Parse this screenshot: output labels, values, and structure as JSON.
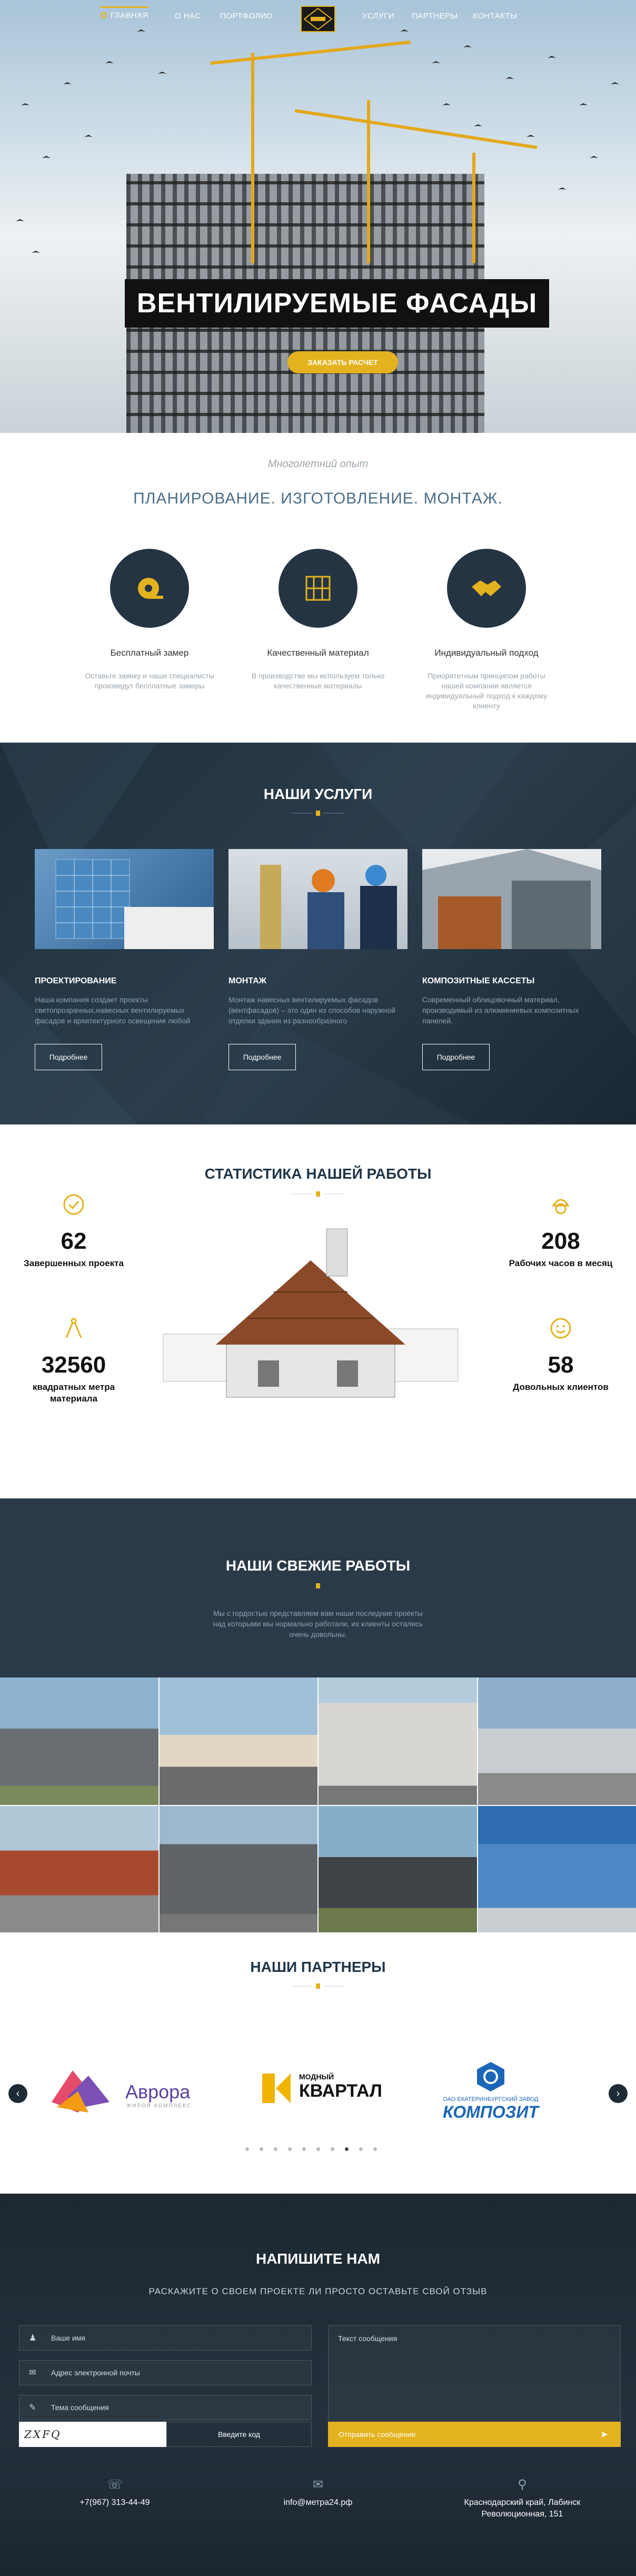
{
  "nav": {
    "left": [
      "ГЛАВНАЯ",
      "О НАС",
      "ПОРТФОЛИО"
    ],
    "right": [
      "УСЛУГИ",
      "ПАРТНЕРЫ",
      "КОНТАКТЫ"
    ],
    "logo_text": "ВЕНТФАСАД"
  },
  "hero": {
    "title": "ВЕНТИЛИРУЕМЫЕ ФАСАДЫ",
    "button": "ЗАКАЗАТЬ РАСЧЕТ"
  },
  "features": {
    "subtitle": "Многолетний опыт",
    "heading": "ПЛАНИРОВАНИЕ. ИЗГОТОВЛЕНИЕ. МОНТАЖ.",
    "items": [
      {
        "title": "Бесплатный замер",
        "desc": "Оставьте заявку и наши специалисты произведут бесплатные замеры",
        "icon": "tape-measure-icon"
      },
      {
        "title": "Качественный материал",
        "desc": "В производстве мы используем только качественные материалы",
        "icon": "material-panels-icon"
      },
      {
        "title": "Индивидуальный подход",
        "desc": "Приоритетным принципом работы нашей компании является индивидуальный подход к каждому клиенту",
        "icon": "handshake-icon"
      }
    ]
  },
  "services": {
    "title": "НАШИ УСЛУГИ",
    "button": "Подробнее",
    "items": [
      {
        "title": "ПРОЕКТИРОВАНИЕ",
        "desc": "Наша компания создает проекты светопрозрачных,навесных вентилируемых фасадов и архитектурного освещения любой"
      },
      {
        "title": "МОНТАЖ",
        "desc": "Монтаж навесных вентилируемых фасадов (вентфасадов) – это один из способов наружной отделки здания из разнообразного"
      },
      {
        "title": "КОМПОЗИТНЫЕ КАССЕТЫ",
        "desc": "Современный облицовочный материал, производимый из алюминиевых композитных панелей."
      }
    ]
  },
  "stats": {
    "title": "СТАТИСТИКА НАШЕЙ РАБОТЫ",
    "items": [
      {
        "num": "62",
        "label": "Завершенных проекта"
      },
      {
        "num": "32560",
        "label": "квадратных метра материала"
      },
      {
        "num": "208",
        "label": "Рабочих часов в месяц"
      },
      {
        "num": "58",
        "label": "Довольных клиентов"
      }
    ]
  },
  "works": {
    "title": "НАШИ СВЕЖИЕ РАБОТЫ",
    "desc": "Мы с гордостью представляем вам наши последние проекты над которыми мы нормально работали, их клиенты остались очень довольны."
  },
  "partners": {
    "title": "НАШИ ПАРТНЕРЫ",
    "logos": [
      {
        "name": "Аврора",
        "sub": "ЖИЛОЙ КОМПЛЕКС"
      },
      {
        "name": "КВАРТАЛ",
        "sub": "МОДНЫЙ"
      },
      {
        "name": "КОМПОЗИТ",
        "sub": "ОАО ЕКАТЕРИНБУРГСКИЙ ЗАВОД"
      }
    ]
  },
  "contact": {
    "title": "НАПИШИТЕ НАМ",
    "subtitle": "РАСКАЖИТЕ О СВОЕМ ПРОЕКТЕ ЛИ ПРОСТО ОСТАВЬТЕ СВОЙ ОТЗЫВ",
    "name_ph": "Ваше имя",
    "email_ph": "Адрес электронной почты",
    "subject_ph": "Тема сообщения",
    "message_ph": "Текст сообщения",
    "captcha": "ZXFQ",
    "code_label": "Введите код",
    "send": "Отправить сообщение",
    "phone": "+7(967) 313-44-49",
    "email": "info@метра24.рф",
    "address": "Краснодарский край, Лабинск Революционная, 151"
  }
}
